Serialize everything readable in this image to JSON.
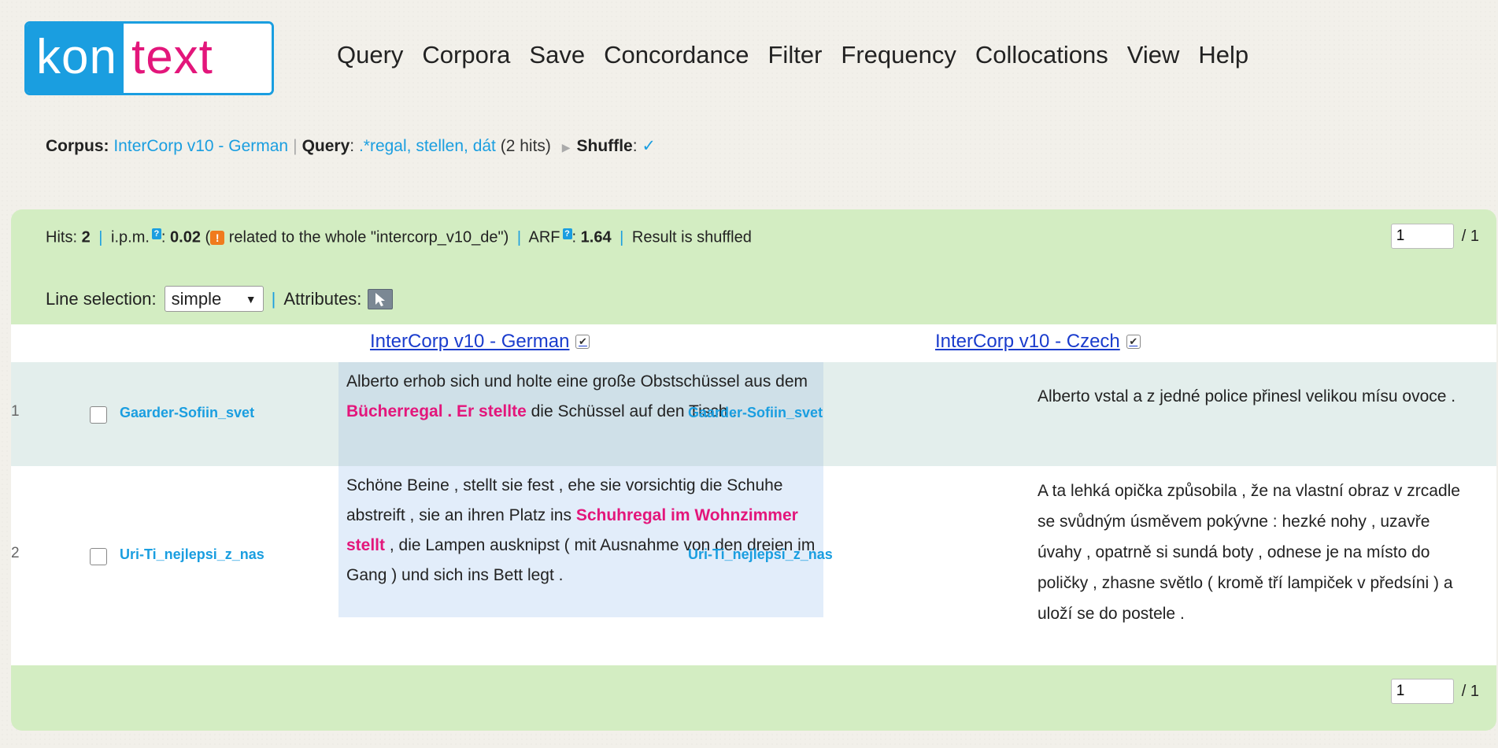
{
  "logo": {
    "part1": "kon",
    "part2": "text"
  },
  "menu": [
    "Query",
    "Corpora",
    "Save",
    "Concordance",
    "Filter",
    "Frequency",
    "Collocations",
    "View",
    "Help"
  ],
  "breadcrumb": {
    "corpus_label": "Corpus:",
    "corpus_value": "InterCorp v10 - German",
    "query_label": "Query",
    "query_value": ".*regal, stellen, dát",
    "hits_note": "(2 hits)",
    "shuffle_label": "Shuffle",
    "shuffle_value": "✓"
  },
  "stats": {
    "hits_label": "Hits:",
    "hits_value": "2",
    "ipm_label": "i.p.m.",
    "ipm_value": "0.02",
    "related_text": "related to the whole \"intercorp_v10_de\")",
    "arf_label": "ARF",
    "arf_value": "1.64",
    "shuffled_text": "Result is shuffled"
  },
  "pager": {
    "page": "1",
    "total": "/ 1"
  },
  "line_selection": {
    "label": "Line selection:",
    "value": "simple",
    "attributes_label": "Attributes:"
  },
  "corpora": [
    {
      "name": "InterCorp v10 - German",
      "checked": true
    },
    {
      "name": "InterCorp v10 - Czech",
      "checked": true
    }
  ],
  "rows": [
    {
      "num": "1",
      "ref": "Gaarder-Sofiin_svet",
      "kwic": [
        {
          "t": "Alberto erhob sich und holte eine große Obstschüssel aus dem ",
          "kw": false
        },
        {
          "t": "Bücherregal . Er stellte",
          "kw": true
        },
        {
          "t": " die Schüssel auf den Tisch .",
          "kw": false
        }
      ],
      "align_ref": "Gaarder-Sofiin_svet",
      "align_text": "Alberto vstal a z jedné police přinesl velikou mísu ovoce ."
    },
    {
      "num": "2",
      "ref": "Uri-Ti_nejlepsi_z_nas",
      "kwic": [
        {
          "t": "Schöne Beine , stellt sie fest , ehe sie vorsichtig die Schuhe abstreift , sie an ihren Platz ins ",
          "kw": false
        },
        {
          "t": "Schuhregal im Wohnzimmer stellt",
          "kw": true
        },
        {
          "t": " , die Lampen ausknipst ( mit Ausnahme von den dreien im Gang ) und sich ins Bett legt .",
          "kw": false
        }
      ],
      "align_ref": "Uri-Ti_nejlepsi_z_nas",
      "align_text": "A ta lehká opička způsobila , že na vlastní obraz v zrcadle se svůdným úsměvem pokývne : hezké nohy , uzavře úvahy , opatrně si sundá boty , odnese je na místo do poličky , zhasne světlo ( kromě tří lampiček v předsíni ) a uloží se do postele ."
    }
  ],
  "colors": {
    "accent": "#1a9ee0",
    "keyword": "#e3167b",
    "panel": "#d3edc2"
  }
}
